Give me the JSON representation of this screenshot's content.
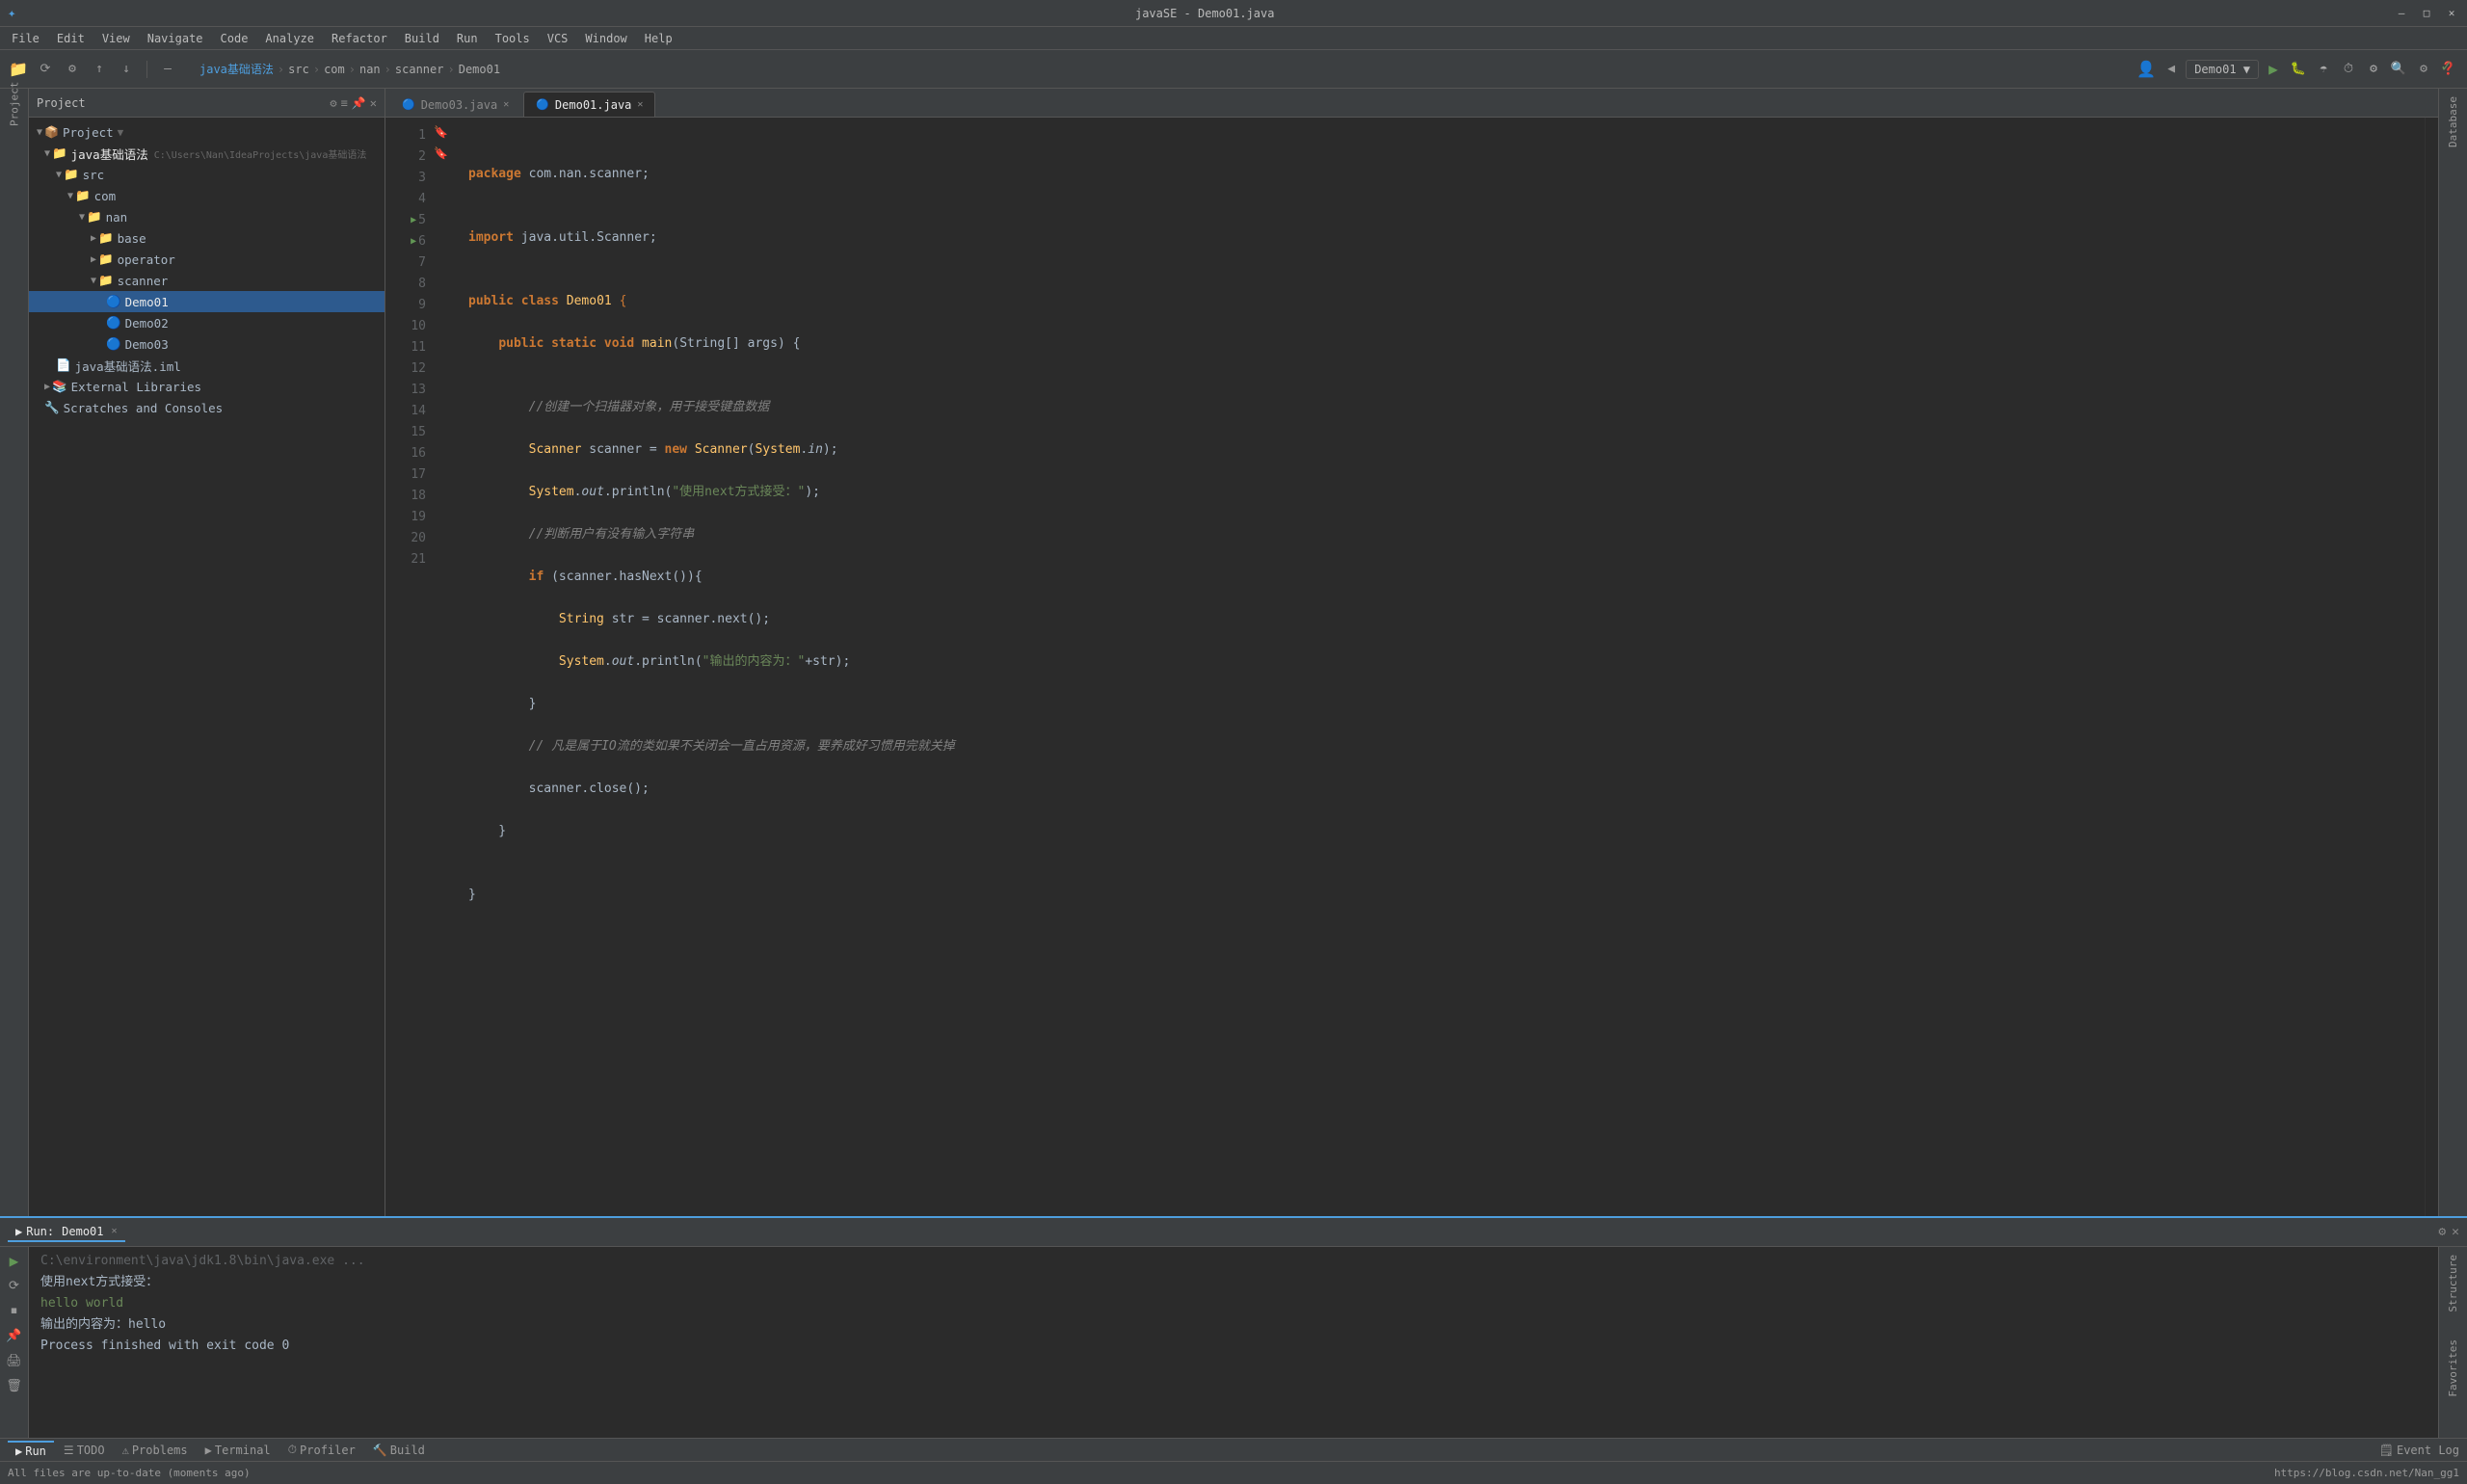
{
  "titlebar": {
    "title": "javaSE - Demo01.java",
    "project_label": "▲",
    "win_min": "—",
    "win_max": "□",
    "win_close": "✕"
  },
  "menubar": {
    "items": [
      "File",
      "Edit",
      "View",
      "Navigate",
      "Code",
      "Analyze",
      "Refactor",
      "Build",
      "Run",
      "Tools",
      "VCS",
      "Window",
      "Help"
    ]
  },
  "toolbar": {
    "project_dropdown": "Project ▼",
    "run_config": "Demo01 ▼",
    "breadcrumb": [
      "java基础语法",
      "src",
      "com",
      "nan",
      "scanner",
      "Demo01"
    ]
  },
  "project": {
    "header": "Project",
    "tree": [
      {
        "label": "Project ▼",
        "indent": 0,
        "icon": "📁",
        "type": "root"
      },
      {
        "label": "java基础语法",
        "indent": 1,
        "icon": "📁",
        "type": "folder",
        "path": "C:\\Users\\Nan\\IdeaProjects\\java基础语法"
      },
      {
        "label": "src",
        "indent": 2,
        "icon": "📁",
        "type": "src"
      },
      {
        "label": "com",
        "indent": 3,
        "icon": "📁",
        "type": "package"
      },
      {
        "label": "nan",
        "indent": 4,
        "icon": "📁",
        "type": "package"
      },
      {
        "label": "base",
        "indent": 5,
        "icon": "📁",
        "type": "package"
      },
      {
        "label": "operator",
        "indent": 5,
        "icon": "📁",
        "type": "package"
      },
      {
        "label": "scanner",
        "indent": 5,
        "icon": "📁",
        "type": "package",
        "selected": false
      },
      {
        "label": "Demo01",
        "indent": 6,
        "icon": "🔵",
        "type": "class",
        "selected": true
      },
      {
        "label": "Demo02",
        "indent": 6,
        "icon": "🔵",
        "type": "class"
      },
      {
        "label": "Demo03",
        "indent": 6,
        "icon": "🔵",
        "type": "class"
      },
      {
        "label": "java基础语法.iml",
        "indent": 2,
        "icon": "📄",
        "type": "file"
      },
      {
        "label": "External Libraries",
        "indent": 1,
        "icon": "📚",
        "type": "lib",
        "collapsed": true
      },
      {
        "label": "Scratches and Consoles",
        "indent": 1,
        "icon": "🔧",
        "type": "scratches"
      }
    ]
  },
  "tabs": [
    {
      "label": "Demo03.java",
      "active": false
    },
    {
      "label": "Demo01.java",
      "active": true
    }
  ],
  "code": {
    "lines": [
      {
        "num": 1,
        "content": "package com.nan.scanner;"
      },
      {
        "num": 2,
        "content": ""
      },
      {
        "num": 3,
        "content": "import java.util.Scanner;"
      },
      {
        "num": 4,
        "content": ""
      },
      {
        "num": 5,
        "content": "public class Demo01 {",
        "has_run": true
      },
      {
        "num": 6,
        "content": "    public static void main(String[] args) {",
        "has_run": true
      },
      {
        "num": 7,
        "content": ""
      },
      {
        "num": 8,
        "content": "        //创建一个扫描器对象，用于接受键盘数据"
      },
      {
        "num": 9,
        "content": "        Scanner scanner = new Scanner(System.in);"
      },
      {
        "num": 10,
        "content": "        System.out.println(\"使用next方式接受：\");"
      },
      {
        "num": 11,
        "content": "        //判断用户有没有输入字符串"
      },
      {
        "num": 12,
        "content": "        if (scanner.hasNext()){",
        "has_bookmark": true
      },
      {
        "num": 13,
        "content": "            String str = scanner.next();"
      },
      {
        "num": 14,
        "content": "            System.out.println(\"输出的内容为：\"+str);"
      },
      {
        "num": 15,
        "content": "        }"
      },
      {
        "num": 16,
        "content": "        // 凡是属于IO流的类如果不关闭会一直占用资源，要养成好习惯用完就关掉"
      },
      {
        "num": 17,
        "content": "        scanner.close();"
      },
      {
        "num": 18,
        "content": "    }",
        "has_bookmark": true
      },
      {
        "num": 19,
        "content": ""
      },
      {
        "num": 20,
        "content": "}"
      },
      {
        "num": 21,
        "content": ""
      }
    ]
  },
  "run_panel": {
    "tab_label": "Run:",
    "config_name": "Demo01",
    "command": "C:\\environment\\java\\jdk1.8\\bin\\java.exe ...",
    "output_lines": [
      {
        "text": "使用next方式接受：",
        "color": "normal"
      },
      {
        "text": "hello world",
        "color": "green"
      },
      {
        "text": "输出的内容为：hello",
        "color": "normal"
      },
      {
        "text": "",
        "color": "normal"
      },
      {
        "text": "Process finished with exit code 0",
        "color": "normal"
      }
    ]
  },
  "statusbar": {
    "left": "All files are up-to-date (moments ago)",
    "right": "https://blog.csdn.net/Nan_gg1"
  },
  "right_panel": {
    "label": "Database"
  },
  "bottom_tabs": [
    {
      "label": "▶ Run",
      "active": true
    },
    {
      "label": "☰ TODO"
    },
    {
      "label": "⚠ Problems"
    },
    {
      "label": "▶ Terminal"
    },
    {
      "label": "⏱ Profiler"
    },
    {
      "label": "🔨 Build"
    }
  ],
  "bottom_right": {
    "label": "Event Log"
  }
}
